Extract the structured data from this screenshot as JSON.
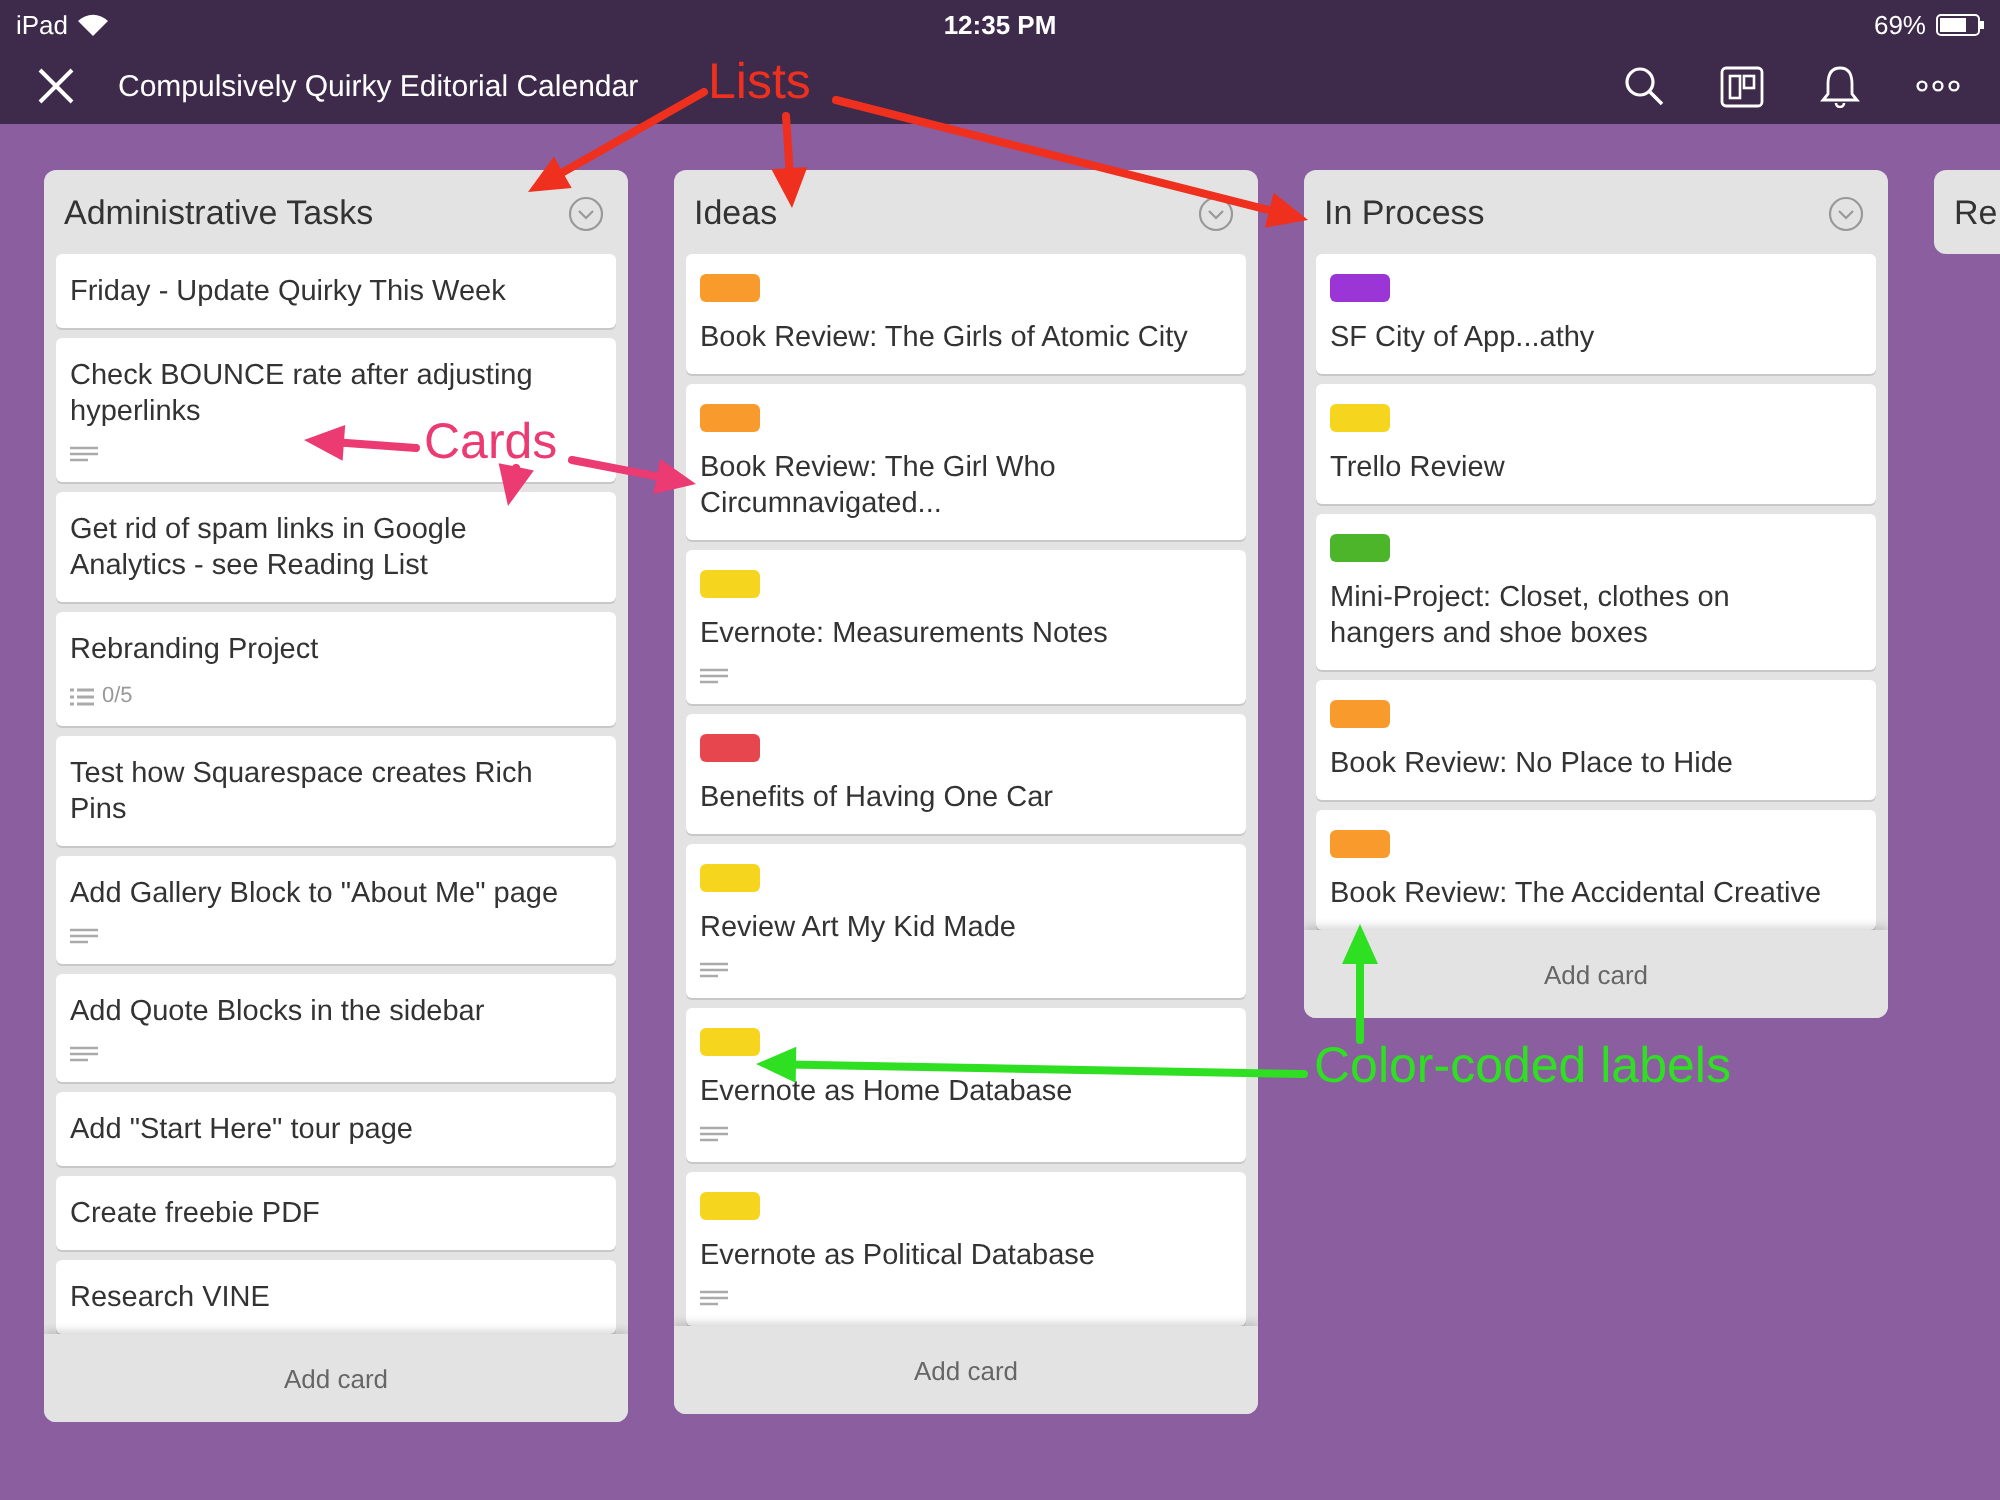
{
  "status_bar": {
    "device": "iPad",
    "time": "12:35 PM",
    "battery": "69%"
  },
  "header": {
    "title": "Compulsively Quirky Editorial Calendar"
  },
  "lists": [
    {
      "title": "Administrative Tasks",
      "add_card": "Add card",
      "cards": [
        {
          "title": "Friday - Update Quirky This Week",
          "description": false
        },
        {
          "title": "Check BOUNCE rate after adjusting hyperlinks",
          "description": true
        },
        {
          "title": "Get rid of spam links in Google Analytics - see Reading List",
          "description": false
        },
        {
          "title": "Rebranding Project",
          "description": false,
          "checklist": "0/5"
        },
        {
          "title": "Test how Squarespace creates Rich Pins",
          "description": false
        },
        {
          "title": "Add Gallery Block to \"About Me\" page",
          "description": true
        },
        {
          "title": "Add Quote Blocks in the sidebar",
          "description": true
        },
        {
          "title": "Add \"Start Here\" tour page",
          "description": false
        },
        {
          "title": "Create freebie PDF",
          "description": false
        },
        {
          "title": "Research VINE",
          "description": false
        }
      ]
    },
    {
      "title": "Ideas",
      "add_card": "Add card",
      "cards": [
        {
          "title": "Book Review: The Girls of Atomic City",
          "color": "#f89a2c",
          "description": false
        },
        {
          "title": "Book Review: The Girl Who Circumnavigated...",
          "color": "#f89a2c",
          "description": false
        },
        {
          "title": "Evernote: Measurements Notes",
          "color": "#f5d51e",
          "description": true
        },
        {
          "title": "Benefits of Having One Car",
          "color": "#e8464f",
          "description": false
        },
        {
          "title": "Review Art My Kid Made",
          "color": "#f5d51e",
          "description": true
        },
        {
          "title": "Evernote as Home Database",
          "color": "#f5d51e",
          "description": true
        },
        {
          "title": "Evernote as Political Database",
          "color": "#f5d51e",
          "description": true
        }
      ]
    },
    {
      "title": "In Process",
      "add_card": "Add card",
      "cards": [
        {
          "title": "SF City of App...athy",
          "color": "#9b35d6",
          "description": false
        },
        {
          "title": "Trello Review",
          "color": "#f5d51e",
          "description": false
        },
        {
          "title": "Mini-Project: Closet, clothes on hangers and shoe boxes",
          "color": "#4cb52a",
          "description": false
        },
        {
          "title": "Book Review: No Place to Hide",
          "color": "#f89a2c",
          "description": false
        },
        {
          "title": "Book Review: The Accidental Creative",
          "color": "#f89a2c",
          "description": false
        }
      ]
    },
    {
      "title": "Re"
    }
  ],
  "annotations": [
    {
      "text": "Lists",
      "color": "#f0301e"
    },
    {
      "text": "Cards",
      "color": "#ec3a72"
    },
    {
      "text": "Color-coded labels",
      "color": "#2ee021"
    }
  ]
}
